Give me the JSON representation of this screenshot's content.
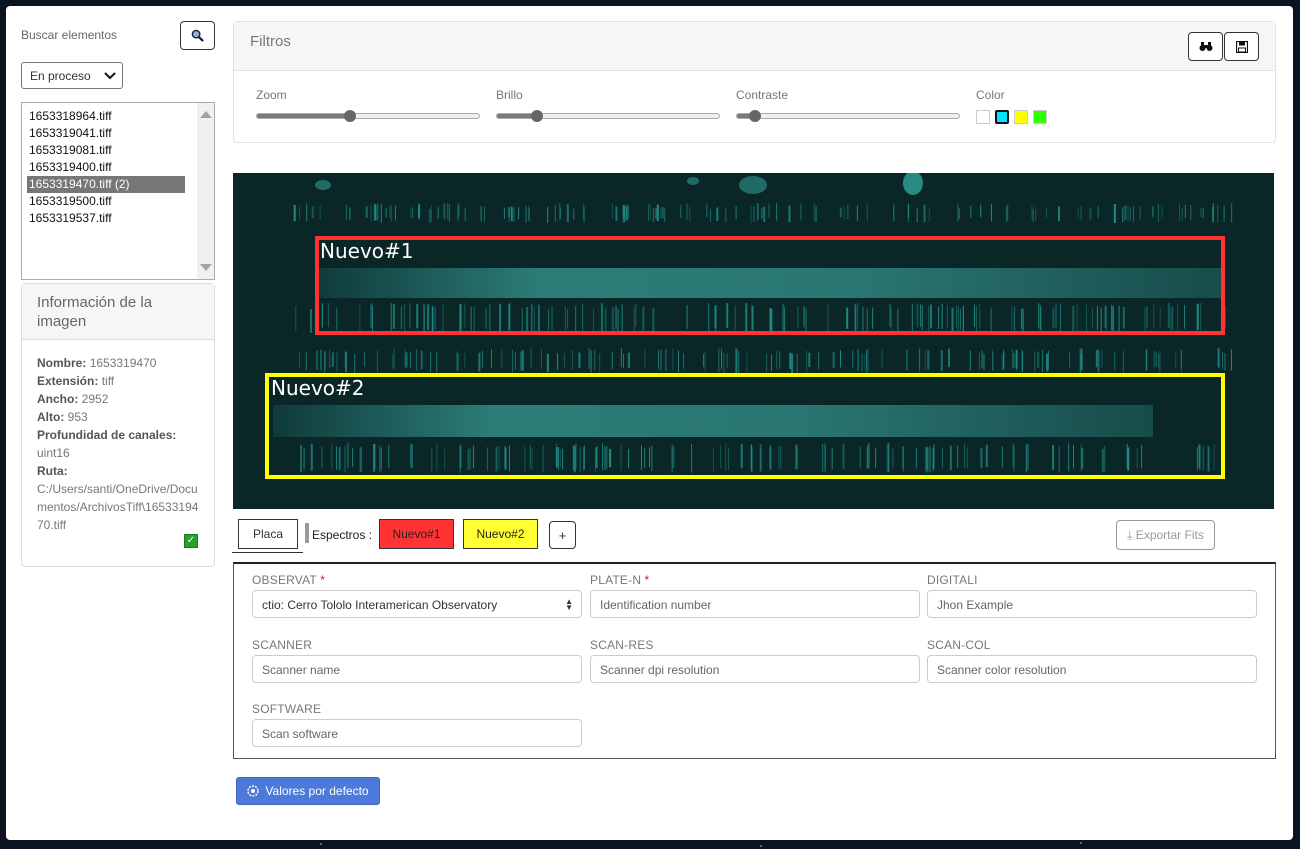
{
  "sidebar": {
    "search_label": "Buscar elementos",
    "status_select": "En proceso",
    "files": [
      {
        "name": "1653318964.tiff",
        "selected": false
      },
      {
        "name": "1653319041.tiff",
        "selected": false
      },
      {
        "name": "1653319081.tiff",
        "selected": false
      },
      {
        "name": "1653319400.tiff",
        "selected": false
      },
      {
        "name": "1653319470.tiff (2)",
        "selected": true
      },
      {
        "name": "1653319500.tiff",
        "selected": false
      },
      {
        "name": "1653319537.tiff",
        "selected": false
      }
    ],
    "info": {
      "title": "Información de la imagen",
      "nombre_label": "Nombre:",
      "nombre": "1653319470",
      "extension_label": "Extensión:",
      "extension": "tiff",
      "ancho_label": "Ancho:",
      "ancho": "2952",
      "alto_label": "Alto:",
      "alto": "953",
      "profundidad_label": "Profundidad de canales:",
      "profundidad": "uint16",
      "ruta_label": "Ruta:",
      "ruta": "C:/Users/santi/OneDrive/Documentos/ArchivosTiff\\1653319470.tiff"
    }
  },
  "filters": {
    "title": "Filtros",
    "sliders": [
      {
        "label": "Zoom",
        "value": 0.42
      },
      {
        "label": "Brillo",
        "value": 0.18
      },
      {
        "label": "Contraste",
        "value": 0.08
      }
    ],
    "color_label": "Color",
    "colors": [
      {
        "name": "white",
        "hex": "#ffffff",
        "active": false
      },
      {
        "name": "cyan",
        "hex": "#00e5ff",
        "active": true
      },
      {
        "name": "yellow",
        "hex": "#ffff00",
        "active": false
      },
      {
        "name": "green",
        "hex": "#33ff00",
        "active": false
      }
    ]
  },
  "viewer": {
    "regions": [
      {
        "label": "Nuevo#1",
        "color": "#ff3333"
      },
      {
        "label": "Nuevo#2",
        "color": "#ffff00"
      }
    ]
  },
  "tabs": {
    "placa": "Placa",
    "spectra_label": "Espectros :",
    "spectra": [
      {
        "label": "Nuevo#1",
        "color": "#ff3333"
      },
      {
        "label": "Nuevo#2",
        "color": "#ffff33"
      }
    ],
    "add": "+",
    "export": "⤓ Exportar Fits"
  },
  "form": {
    "observat_label": "OBSERVAT",
    "observat_value": "ctio: Cerro Tololo Interamerican Observatory",
    "platen_label": "PLATE-N",
    "platen_placeholder": "Identification number",
    "digitali_label": "DIGITALI",
    "digitali_value": "Jhon Example",
    "scanner_label": "SCANNER",
    "scanner_placeholder": "Scanner name",
    "scanres_label": "SCAN-RES",
    "scanres_placeholder": "Scanner dpi resolution",
    "scancol_label": "SCAN-COL",
    "scancol_placeholder": "Scanner color resolution",
    "software_label": "SOFTWARE",
    "software_placeholder": "Scan software",
    "required_mark": "*"
  },
  "default_button": "Valores por defecto"
}
